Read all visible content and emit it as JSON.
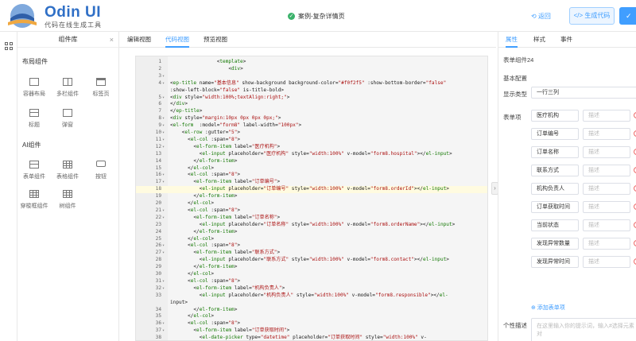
{
  "header": {
    "brand_name": "Odin UI",
    "brand_sub": "代码在线生成工具",
    "case_title": "案例-复杂详情页",
    "back_label": "返回",
    "generate_label": "</> 生成代码",
    "confirm_label": "✓"
  },
  "library": {
    "title": "组件库",
    "close": "×",
    "groups": [
      {
        "title": "布局组件",
        "items": [
          "容器布局",
          "多栏组件",
          "标签页",
          "标题",
          "弹窗"
        ]
      },
      {
        "title": "AI组件",
        "items": [
          "表单组件",
          "表格组件",
          "按钮",
          "穿梭框组件",
          "树组件"
        ]
      }
    ]
  },
  "center": {
    "tabs": [
      "编辑视图",
      "代码视图",
      "预览视图"
    ],
    "active_tab": "代码视图",
    "handle": "›"
  },
  "code_lines": [
    {
      "n": "1",
      "fold": "",
      "text": "                <template>"
    },
    {
      "n": "2",
      "fold": "",
      "text": "                    <div>"
    },
    {
      "n": "3",
      "fold": "▾",
      "text": ""
    },
    {
      "n": "4",
      "fold": "▾",
      "text": "<ep-title name=\"基本信息\" show-background background-color=\"#f0f2f5\" :show-bottom-border=\"false\""
    },
    {
      "n": "",
      "fold": "",
      "text": ":show-left-block=\"false\" is-title-bold>"
    },
    {
      "n": "5",
      "fold": "▾",
      "text": "<div style=\"width:100%;textAlign:right;\">"
    },
    {
      "n": "6",
      "fold": "",
      "text": "</div>"
    },
    {
      "n": "7",
      "fold": "",
      "text": "</ep-title>"
    },
    {
      "n": "8",
      "fold": "▾",
      "text": "<div style=\"margin:10px 0px 0px 0px;\">"
    },
    {
      "n": "9",
      "fold": "▾",
      "text": "<el-form  :model=\"form8\" label-width=\"100px\">"
    },
    {
      "n": "10",
      "fold": "▾",
      "text": "    <el-row :gutter=\"5\">"
    },
    {
      "n": "11",
      "fold": "▾",
      "text": "      <el-col :span=\"8\">"
    },
    {
      "n": "12",
      "fold": "▾",
      "text": "        <el-form-item label=\"医疗机构\">"
    },
    {
      "n": "13",
      "fold": "",
      "text": "          <el-input placeholder=\"医疗机构\" style=\"width:100%\" v-model=\"form8.hospital\"></el-input>"
    },
    {
      "n": "14",
      "fold": "",
      "text": "        </el-form-item>"
    },
    {
      "n": "15",
      "fold": "",
      "text": "      </el-col>"
    },
    {
      "n": "16",
      "fold": "▾",
      "text": "      <el-col :span=\"8\">"
    },
    {
      "n": "17",
      "fold": "▾",
      "text": "        <el-form-item label=\"订单编号\">"
    },
    {
      "n": "18",
      "fold": "",
      "text": "          <el-input placeholder=\"订单编号\" style=\"width:100%\" v-model=\"form8.orderId\"></el-input>",
      "hl": true
    },
    {
      "n": "19",
      "fold": "",
      "text": "        </el-form-item>"
    },
    {
      "n": "20",
      "fold": "",
      "text": "      </el-col>"
    },
    {
      "n": "21",
      "fold": "▾",
      "text": "      <el-col :span=\"8\">"
    },
    {
      "n": "22",
      "fold": "▾",
      "text": "        <el-form-item label=\"订单名称\">"
    },
    {
      "n": "23",
      "fold": "",
      "text": "          <el-input placeholder=\"订单名称\" style=\"width:100%\" v-model=\"form8.orderName\"></el-input>"
    },
    {
      "n": "24",
      "fold": "",
      "text": "        </el-form-item>"
    },
    {
      "n": "25",
      "fold": "",
      "text": "      </el-col>"
    },
    {
      "n": "26",
      "fold": "▾",
      "text": "      <el-col :span=\"8\">"
    },
    {
      "n": "27",
      "fold": "▾",
      "text": "        <el-form-item label=\"联系方式\">"
    },
    {
      "n": "28",
      "fold": "",
      "text": "          <el-input placeholder=\"联系方式\" style=\"width:100%\" v-model=\"form8.contact\"></el-input>"
    },
    {
      "n": "29",
      "fold": "",
      "text": "        </el-form-item>"
    },
    {
      "n": "30",
      "fold": "",
      "text": "      </el-col>"
    },
    {
      "n": "31",
      "fold": "▾",
      "text": "      <el-col :span=\"8\">"
    },
    {
      "n": "32",
      "fold": "▾",
      "text": "        <el-form-item label=\"机构负责人\">"
    },
    {
      "n": "33",
      "fold": "",
      "text": "          <el-input placeholder=\"机构负责人\" style=\"width:100%\" v-model=\"form8.responsible\"></el-"
    },
    {
      "n": "",
      "fold": "",
      "text": "input>"
    },
    {
      "n": "34",
      "fold": "",
      "text": "        </el-form-item>"
    },
    {
      "n": "35",
      "fold": "",
      "text": "      </el-col>"
    },
    {
      "n": "36",
      "fold": "▾",
      "text": "      <el-col :span=\"8\">"
    },
    {
      "n": "37",
      "fold": "▾",
      "text": "        <el-form-item label=\"订单获取时间\">"
    },
    {
      "n": "38",
      "fold": "",
      "text": "          <el-date-picker type=\"datetime\" placeholder=\"订单获取时间\" style=\"width:100%\" v-"
    }
  ],
  "props": {
    "tabs": [
      "属性",
      "样式",
      "事件"
    ],
    "active_tab": "属性",
    "component_id": "表单组件24",
    "section_basic": "基本配置",
    "display_label": "显示类型",
    "display_value": "一行三列",
    "form_items_label": "表单项",
    "desc_placeholder": "描述",
    "items": [
      "医疗机构",
      "订单编号",
      "订单名称",
      "联系方式",
      "机构负责人",
      "订单获取时间",
      "当前状态",
      "发现异常数量",
      "发现异常时间"
    ],
    "add_item": "⊕ 添加表单项",
    "custom_desc_label": "个性描述",
    "custom_desc_placeholder": "在这里输入你的提示词，输入#选择元素对"
  }
}
